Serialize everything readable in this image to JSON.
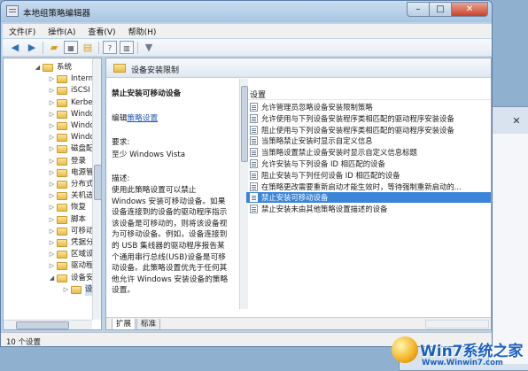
{
  "window": {
    "title": "本地组策略编辑器"
  },
  "menu": [
    "文件(F)",
    "操作(A)",
    "查看(V)",
    "帮助(H)"
  ],
  "tree": {
    "items": [
      {
        "label": "系统",
        "expanded": true
      },
      {
        "label": "Intern",
        "expanded": false
      },
      {
        "label": "iSCSI",
        "expanded": false
      },
      {
        "label": "Kerbe",
        "expanded": false
      },
      {
        "label": "Windo",
        "expanded": false
      },
      {
        "label": "Windo",
        "expanded": false
      },
      {
        "label": "Windo",
        "expanded": false
      },
      {
        "label": "磁盘配",
        "expanded": false
      },
      {
        "label": "登录",
        "expanded": false
      },
      {
        "label": "电源管",
        "expanded": false
      },
      {
        "label": "分布式",
        "expanded": false
      },
      {
        "label": "关机选",
        "expanded": false
      },
      {
        "label": "恢复",
        "expanded": false
      },
      {
        "label": "脚本",
        "expanded": false
      },
      {
        "label": "可移动",
        "expanded": false
      },
      {
        "label": "凭据分",
        "expanded": false
      },
      {
        "label": "区域设",
        "expanded": false
      },
      {
        "label": "驱动程",
        "expanded": false
      },
      {
        "label": "设备安",
        "expanded": true
      },
      {
        "label": "设备",
        "expanded": false
      }
    ]
  },
  "pane": {
    "header": "设备安装限制",
    "policy_title": "禁止安装可移动设备",
    "edit_prefix": "编辑",
    "edit_link": "策略设置",
    "req_label": "要求:",
    "req_value": "至少 Windows Vista",
    "desc_label": "描述:",
    "desc_body": "使用此策略设置可以禁止\nWindows 安装可移动设备。如果\n设备连接到的设备的驱动程序指示\n该设备是可移动的，则将该设备视\n为可移动设备。例如，设备连接到\n的 USB 集线器的驱动程序报告某\n个通用串行总线(USB)设备是可移\n动设备。此策略设置优先于任何其\n他允许 Windows 安装设备的策略\n设置。",
    "settings_header": "设置"
  },
  "settings": [
    {
      "label": "允许管理员忽略设备安装限制策略",
      "selected": false
    },
    {
      "label": "允许使用与下列设备安装程序类相匹配的驱动程序安装设备",
      "selected": false
    },
    {
      "label": "阻止使用与下列设备安装程序类相匹配的驱动程序安装设备",
      "selected": false
    },
    {
      "label": "当策略禁止安装时显示自定义信息",
      "selected": false
    },
    {
      "label": "当策略设置禁止设备安装时显示自定义信息标题",
      "selected": false
    },
    {
      "label": "允许安装与下列设备 ID 相匹配的设备",
      "selected": false
    },
    {
      "label": "阻止安装与下列任何设备 ID 相匹配的设备",
      "selected": false
    },
    {
      "label": "在策略更改需要重新启动才能生效时，等待强制重新启动的...",
      "selected": false
    },
    {
      "label": "禁止安装可移动设备",
      "selected": true
    },
    {
      "label": "禁止安装未由其他策略设置描述的设备",
      "selected": false
    }
  ],
  "tabs": [
    "扩展",
    "标准"
  ],
  "status": "10 个设置",
  "watermark": {
    "brand": "Win7系统之家",
    "url": "Www.Winwin7.com"
  }
}
